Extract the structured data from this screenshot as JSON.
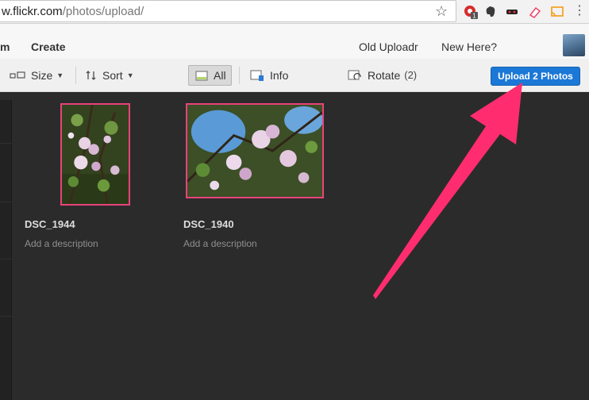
{
  "browser": {
    "url_host": "w.flickr.com",
    "url_path": "/photos/upload/",
    "extension_badge": "1",
    "icons": [
      "star-icon",
      "chrome-extension-icon",
      "evernote-icon",
      "mask-icon",
      "eraser-icon",
      "cast-icon",
      "menu-icon"
    ]
  },
  "header": {
    "nav_left_partial": "m",
    "create": "Create",
    "old_uploadr": "Old Uploadr",
    "new_here": "New Here?"
  },
  "toolbar": {
    "size": "Size",
    "sort": "Sort",
    "all": "All",
    "info": "Info",
    "rotate": "Rotate",
    "rotate_count": "(2)",
    "upload_button": "Upload 2 Photos"
  },
  "photos": [
    {
      "title": "DSC_1944",
      "description": "Add a description"
    },
    {
      "title": "DSC_1940",
      "description": "Add a description"
    }
  ],
  "colors": {
    "accent": "#e9427b",
    "upload_button": "#1c78d6",
    "workspace_bg": "#2b2b2b",
    "annotation_arrow": "#ff2d6f"
  }
}
